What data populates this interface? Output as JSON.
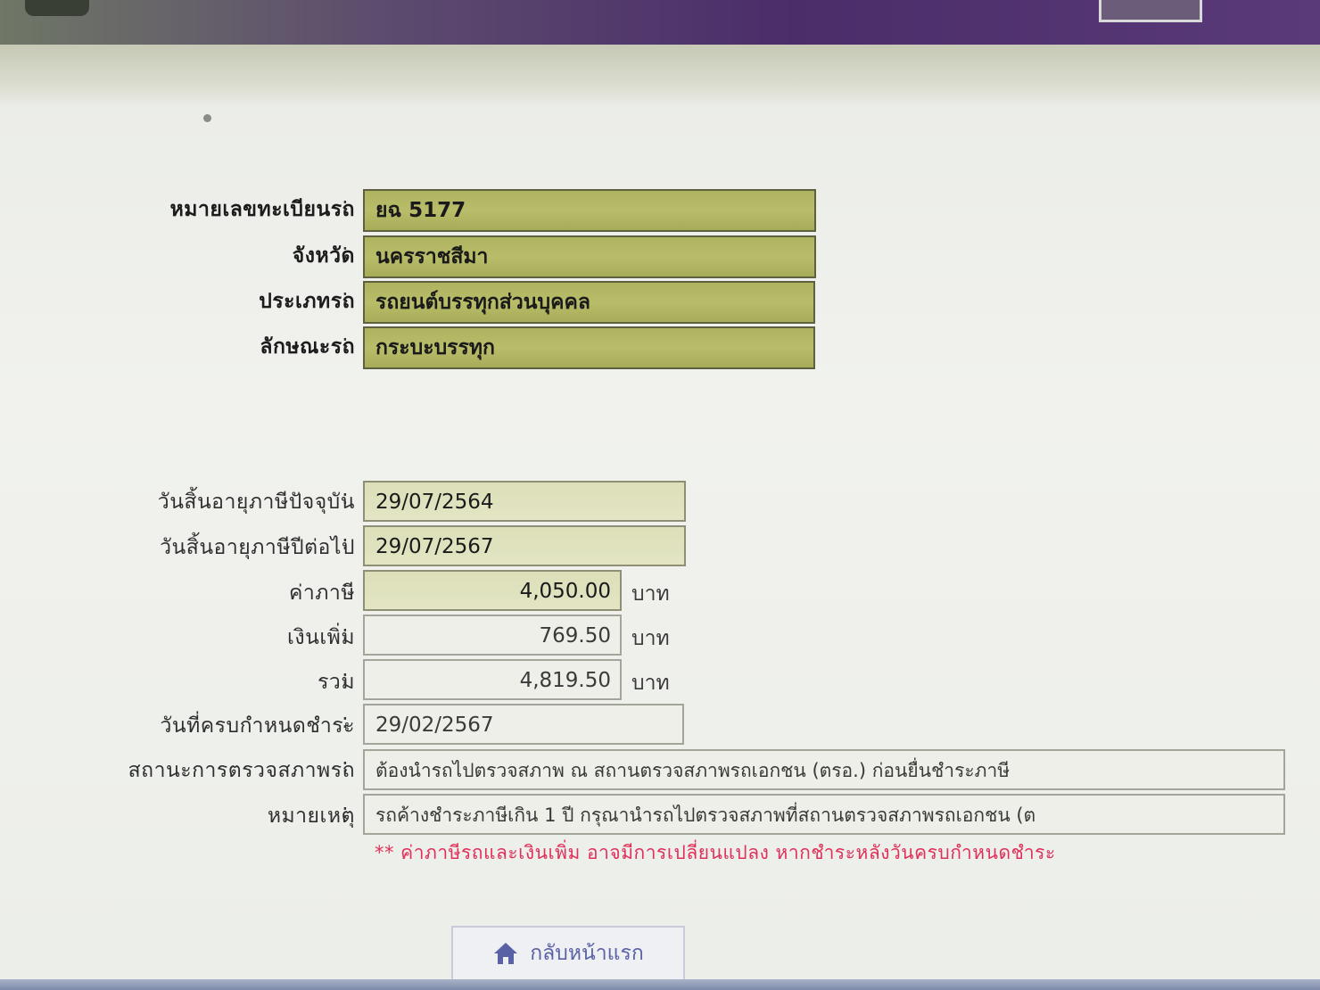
{
  "vehicle": {
    "plate_label": "หมายเลขทะเบียนรถ",
    "plate_value": "ยฉ 5177",
    "province_label": "จังหวัด",
    "province_value": "นครราชสีมา",
    "type_label": "ประเภทรถ",
    "type_value": "รถยนต์บรรทุกส่วนบุคคล",
    "style_label": "ลักษณะรถ",
    "style_value": "กระบะบรรทุก"
  },
  "tax": {
    "current_expiry_label": "วันสิ้นอายุภาษีปัจจุบัน",
    "current_expiry_value": "29/07/2564",
    "next_expiry_label": "วันสิ้นอายุภาษีปีต่อไป",
    "next_expiry_value": "29/07/2567",
    "tax_label": "ค่าภาษี",
    "tax_value": "4,050.00",
    "surcharge_label": "เงินเพิ่ม",
    "surcharge_value": "769.50",
    "total_label": "รวม",
    "total_value": "4,819.50",
    "currency_unit": "บาท",
    "due_date_label": "วันที่ครบกำหนดชำระ",
    "due_date_value": "29/02/2567",
    "inspection_label": "สถานะการตรวจสภาพรถ",
    "inspection_value": "ต้องนำรถไปตรวจสภาพ ณ สถานตรวจสภาพรถเอกชน (ตรอ.) ก่อนยื่นชำระภาษี",
    "remark_label": "หมายเหตุ",
    "remark_value": "รถค้างชำระภาษีเกิน 1 ปี กรุณานำรถไปตรวจสภาพที่สถานตรวจสภาพรถเอกชน (ต",
    "warning": "** ค่าภาษีรถและเงินเพิ่ม อาจมีการเปลี่ยนแปลง หากชำระหลังวันครบกำหนดชำระ"
  },
  "colon": ":",
  "home_button_label": "กลับหน้าแรก",
  "icons": {
    "home": "home-icon"
  },
  "colors": {
    "highlight_field": "#b2b764",
    "tinted_field": "#dfe2bd",
    "warning_text": "#e0305a",
    "header": "#4b2d6a"
  }
}
